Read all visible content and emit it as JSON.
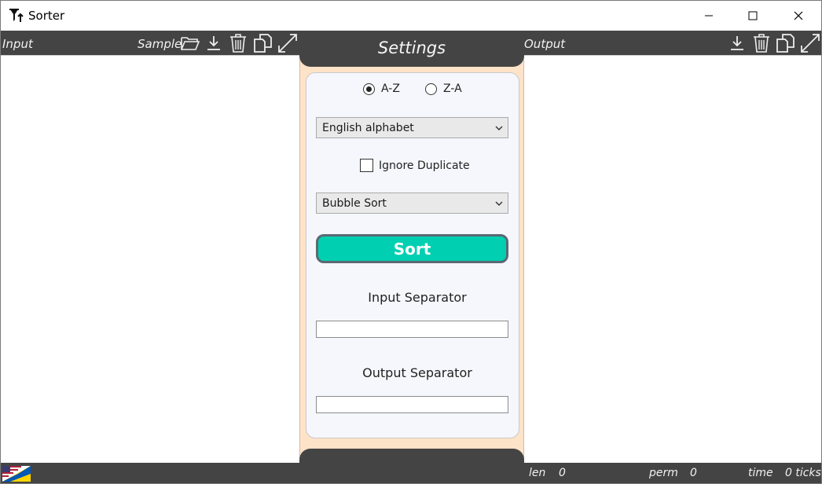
{
  "window": {
    "title": "Sorter",
    "icon": "sorter-funnel-icon"
  },
  "input_panel": {
    "label": "Input",
    "sample_label": "Sample",
    "tools": [
      "folder-open-icon",
      "download-icon",
      "trash-icon",
      "copy-icon",
      "expand-icon"
    ],
    "content": ""
  },
  "settings": {
    "title": "Settings",
    "order_options": [
      {
        "label": "A-Z",
        "selected": true
      },
      {
        "label": "Z-A",
        "selected": false
      }
    ],
    "alphabet_select": {
      "value": "English alphabet"
    },
    "ignore_duplicate": {
      "label": "Ignore Duplicate",
      "checked": false
    },
    "algorithm_select": {
      "value": "Bubble Sort"
    },
    "sort_button": "Sort",
    "input_separator": {
      "label": "Input Separator",
      "value": ""
    },
    "output_separator": {
      "label": "Output Separator",
      "value": ""
    }
  },
  "output_panel": {
    "label": "Output",
    "tools": [
      "download-icon",
      "trash-icon",
      "copy-icon",
      "expand-icon"
    ],
    "content": ""
  },
  "status": {
    "language_flag": "us-ua-flag-icon",
    "len_label": "len",
    "len_value": "0",
    "perm_label": "perm",
    "perm_value": "0",
    "time_label": "time",
    "time_value": "0 ticks"
  },
  "colors": {
    "bar": "#444444",
    "settings_bg": "#fde3c8",
    "card_bg": "#f6f7fc",
    "sort_button": "#00cfb1"
  }
}
